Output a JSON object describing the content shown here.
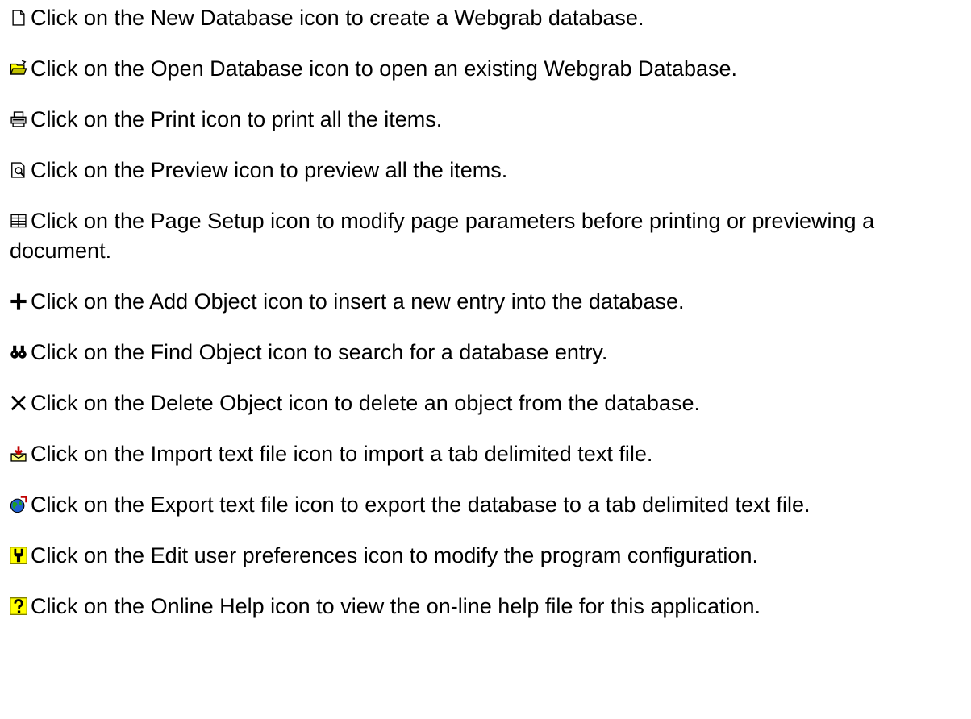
{
  "help_items": [
    {
      "icon": "new-database-icon",
      "text": "Click on the New Database icon to create a Webgrab database."
    },
    {
      "icon": "open-database-icon",
      "text": "Click on the Open Database icon to open an existing Webgrab Database."
    },
    {
      "icon": "print-icon",
      "text": "Click on the Print icon to print all the items."
    },
    {
      "icon": "preview-icon",
      "text": "Click on the Preview icon to preview all the items."
    },
    {
      "icon": "page-setup-icon",
      "text": "Click on the Page Setup icon to modify page parameters before printing or previewing a document."
    },
    {
      "icon": "add-object-icon",
      "text": "Click on the Add Object icon to insert a new entry into the database."
    },
    {
      "icon": "find-object-icon",
      "text": "Click on the Find Object icon to search for a database entry."
    },
    {
      "icon": "delete-object-icon",
      "text": "Click on the Delete Object icon to delete an object from the database."
    },
    {
      "icon": "import-text-file-icon",
      "text": "Click on the Import text file icon to import a tab delimited text file."
    },
    {
      "icon": "export-text-file-icon",
      "text": "Click on the Export text file icon to export the database to a tab delimited text file."
    },
    {
      "icon": "edit-user-preferences-icon",
      "text": "Click on the Edit user preferences icon to modify the program configuration."
    },
    {
      "icon": "online-help-icon",
      "text": "Click on the Online Help icon to view the on-line help file for this application."
    }
  ]
}
